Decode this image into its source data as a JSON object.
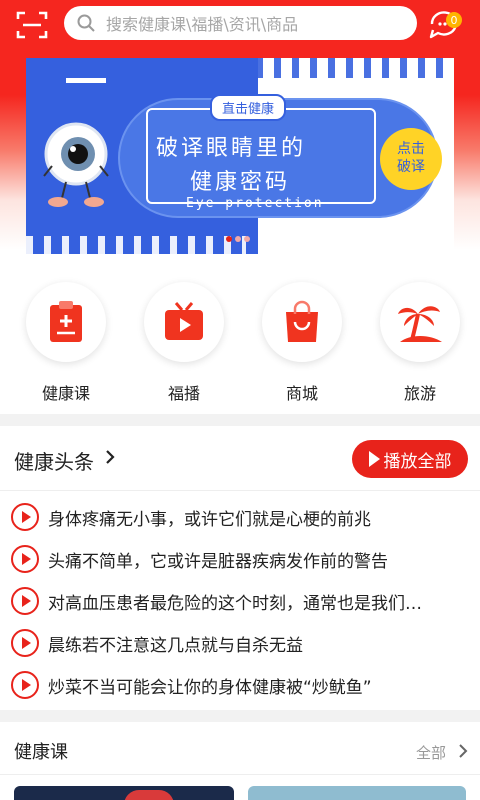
{
  "header": {
    "search_placeholder": "搜索健康课\\福播\\资讯\\商品",
    "message_count": "0"
  },
  "banner": {
    "tag": "直击健康",
    "title_line1": "破译眼睛里的",
    "title_line2": "健康密码",
    "subtitle": "Eye protection",
    "badge": "点击破译",
    "badge_line1": "点击",
    "badge_line2": "破译",
    "slide_count": 3,
    "active_slide": 1
  },
  "categories": [
    {
      "label": "健康课",
      "icon": "clipboard-health-icon"
    },
    {
      "label": "福播",
      "icon": "tv-play-icon"
    },
    {
      "label": "商城",
      "icon": "shopping-bag-icon"
    },
    {
      "label": "旅游",
      "icon": "palm-tree-icon"
    }
  ],
  "headlines": {
    "title": "健康头条",
    "play_all": "播放全部",
    "items": [
      "身体疼痛无小事，或许它们就是心梗的前兆",
      "头痛不简单，它或许是脏器疾病发作前的警告",
      "对高血压患者最危险的这个时刻，通常也是我们…",
      "晨练若不注意这几点就与自杀无益",
      "炒菜不当可能会让你的身体健康被“炒鱿鱼”"
    ]
  },
  "course": {
    "title": "健康课",
    "more": "全部"
  },
  "colors": {
    "brand_red": "#e8231b",
    "banner_blue": "#3560de",
    "badge_yellow": "#ffd326"
  }
}
